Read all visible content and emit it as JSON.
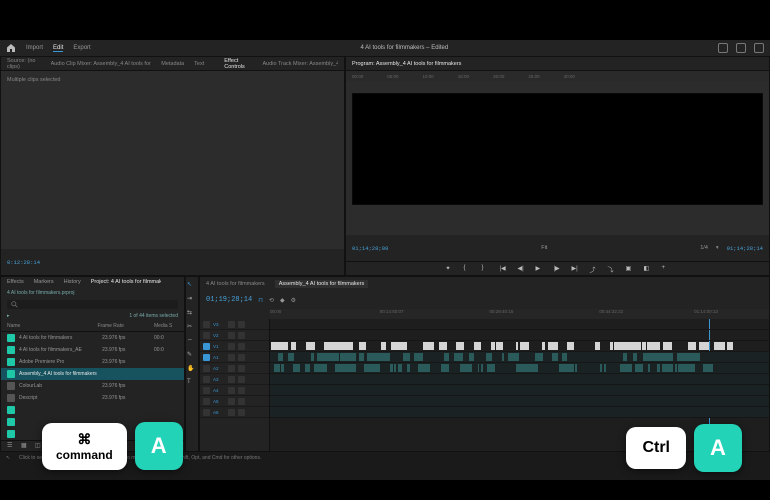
{
  "app": {
    "title": "4 AI tools for filmmakers – Edited",
    "nav": {
      "import": "Import",
      "edit": "Edit",
      "export": "Export"
    }
  },
  "source_panel": {
    "tabs": [
      "Source: (no clips)",
      "Audio Clip Mixer: Assembly_4 AI tools for filmmakers",
      "Metadata",
      "Text"
    ],
    "tabs_right": [
      "Effect Controls",
      "Audio Track Mixer: Assembly_4 AI tools"
    ],
    "active_right": "Effect Controls",
    "message": "Multiple clips selected"
  },
  "program_panel": {
    "tab": "Program: Assembly_4 AI tools for filmmakers",
    "ruler_marks": [
      "00:00",
      "05:00",
      "10:00",
      "15:00",
      "20:00",
      "25:00",
      "30:00",
      "35:00"
    ],
    "tc_left": "01;14;28;09",
    "fit": "Fit",
    "zoom": "1/4",
    "tc_right": "01;14;28;14"
  },
  "project_panel": {
    "tabs": {
      "effects": "Effects",
      "markers": "Markers",
      "history": "History",
      "project": "Project: 4 AI tools for filmmakers"
    },
    "filename": "4 AI tools for filmmakers.prproj",
    "filter_label": "1 of 44 items selected",
    "chevron": "▸",
    "cols": {
      "name": "Name",
      "framerate": "Frame Rate",
      "media": "Media S"
    },
    "rows": [
      {
        "name": "4 AI tools for filmmakers",
        "rate": "23.976 fps",
        "media": "00:0",
        "chip": "teal"
      },
      {
        "name": "4 AI tools for filmmakers_AE",
        "rate": "23.976 fps",
        "media": "00:0",
        "chip": "teal"
      },
      {
        "name": "Adobe Premiere Pro",
        "rate": "23.976 fps",
        "media": "",
        "chip": "teal"
      },
      {
        "name": "Assembly_4 AI tools for filmmakers",
        "rate": "",
        "media": "",
        "chip": "teal",
        "selected": true
      },
      {
        "name": "ColourLab",
        "rate": "23.976 fps",
        "media": "",
        "chip": "gray"
      },
      {
        "name": "Descript",
        "rate": "23.976 fps",
        "media": "",
        "chip": "gray"
      },
      {
        "name": "",
        "rate": "",
        "media": "",
        "chip": "teal"
      },
      {
        "name": "",
        "rate": "",
        "media": "",
        "chip": "teal"
      },
      {
        "name": "",
        "rate": "",
        "media": "",
        "chip": "teal"
      }
    ]
  },
  "timeline": {
    "tabs": [
      "4 AI tools for filmmakers",
      "Assembly_4 AI tools for filmmakers"
    ],
    "active_tab": 1,
    "tc": "01;19;28;14",
    "ruler": [
      "00:00",
      "00:14:50:07",
      "00:29:40:15",
      "00:44:32:22",
      "01:14:00:13"
    ],
    "playhead_pct": 88,
    "video_tracks": [
      "V3",
      "V2",
      "V1"
    ],
    "audio_tracks": [
      "A1",
      "A2",
      "A3",
      "A4",
      "A5",
      "A6"
    ]
  },
  "status": {
    "text": "Click to select, or click in empty space and drag to marquee select. Use Shift, Opt, and Cmd for other options."
  },
  "shortcuts": {
    "mac_modifier_symbol": "⌘",
    "mac_modifier_label": "command",
    "letter": "A",
    "win_modifier": "Ctrl"
  },
  "colors": {
    "accent": "#3a97d5",
    "teal": "#22d3b8"
  }
}
